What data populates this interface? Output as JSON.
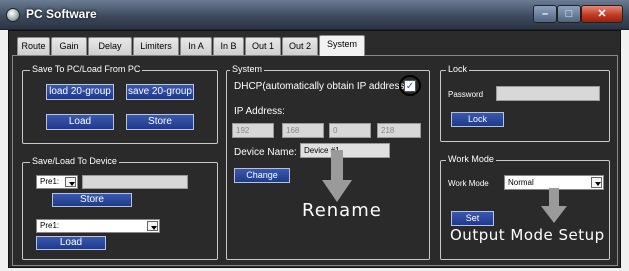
{
  "window": {
    "title": "PC Software",
    "minimize_glyph": "–",
    "maximize_glyph": "□",
    "close_glyph": "✕"
  },
  "tabs": [
    {
      "label": "Route"
    },
    {
      "label": "Gain"
    },
    {
      "label": "Delay"
    },
    {
      "label": "Limiters"
    },
    {
      "label": "In A"
    },
    {
      "label": "In B"
    },
    {
      "label": "Out 1"
    },
    {
      "label": "Out 2"
    },
    {
      "label": "System"
    }
  ],
  "active_tab": "System",
  "save_pc": {
    "title": "Save To PC/Load From PC",
    "load_group_label": "load 20-group",
    "save_group_label": "save 20-group",
    "load_label": "Load",
    "store_label": "Store"
  },
  "save_device": {
    "title": "Save/Load To Device",
    "preset1_value": "Pre1:",
    "store_label": "Store",
    "preset2_value": "Pre1:",
    "load_label": "Load"
  },
  "system": {
    "title": "System",
    "dhcp_label": "DHCP(automatically obtain IP address):",
    "dhcp_checked": true,
    "ip_label": "IP Address:",
    "ip": [
      "192",
      "168",
      "0",
      "218"
    ],
    "device_name_label": "Device Name:",
    "device_name_value": "Device #1",
    "change_label": "Change"
  },
  "lock": {
    "title": "Lock",
    "password_label": "Password",
    "password_value": "",
    "lock_label": "Lock"
  },
  "work_mode": {
    "title": "Work Mode",
    "mode_label": "Work Mode",
    "mode_value": "Normal",
    "set_label": "Set"
  },
  "annotations": {
    "rename": "Rename",
    "output_mode": "Output Mode Setup"
  },
  "colors": {
    "button_blue": "#2a48a0",
    "panel_bg": "#2a2a2a",
    "annotation_circle": "#000000"
  }
}
